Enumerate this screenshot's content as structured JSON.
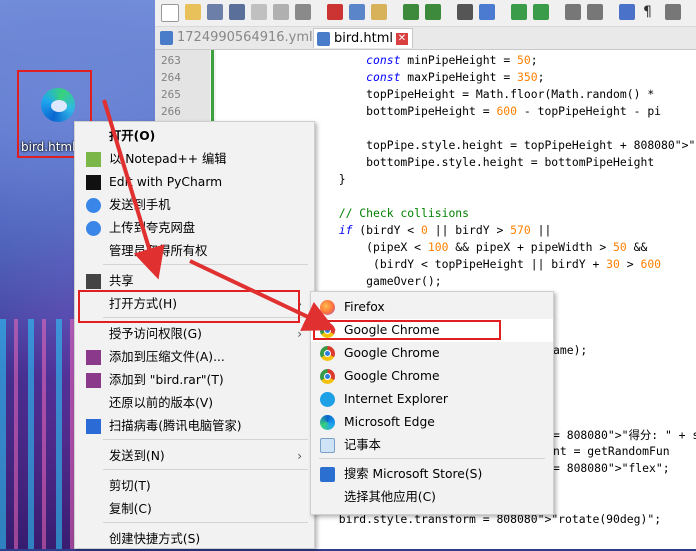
{
  "desktop": {
    "icon_label": "bird.html"
  },
  "editor": {
    "tabs": [
      {
        "label": "1724990564916.yml",
        "active": false
      },
      {
        "label": "bird.html",
        "active": true,
        "close": "✕"
      }
    ],
    "line_numbers": [
      "263",
      "264",
      "265",
      "266"
    ],
    "code_lines": [
      {
        "text": "      const minPipeHeight = 50;"
      },
      {
        "text": "      const maxPipeHeight = 350;"
      },
      {
        "text": "      topPipeHeight = Math.floor(Math.random() *"
      },
      {
        "text": "      bottomPipeHeight = 600 - topPipeHeight - pi"
      },
      {
        "text": ""
      },
      {
        "text": "      topPipe.style.height = topPipeHeight + \"px\""
      },
      {
        "text": "      bottomPipe.style.height = bottomPipeHeight"
      },
      {
        "text": "  }"
      },
      {
        "text": ""
      },
      {
        "text": "  // Check collisions"
      },
      {
        "text": "  if (birdY < 0 || birdY > 570 ||"
      },
      {
        "text": "      (pipeX < 100 && pipeX + pipeWidth > 50 &&"
      },
      {
        "text": "       (birdY < topPipeHeight || birdY + 30 > 600"
      },
      {
        "text": "      gameOver();"
      },
      {
        "text": "ame);"
      },
      {
        "text": "= \"得分: \" + scor"
      },
      {
        "text": "nt = getRandomFun"
      },
      {
        "text": "= \"flex\";"
      },
      {
        "text": "  bird.style.transform = \"rotate(90deg)\";"
      }
    ]
  },
  "context_menu": {
    "items": [
      {
        "label": "打开(O)",
        "icon": "none"
      },
      {
        "label": "以 Notepad++ 编辑",
        "icon": "notepadpp-icon"
      },
      {
        "label": "Edit with PyCharm",
        "icon": "pycharm-icon"
      },
      {
        "label": "发送到手机",
        "icon": "cloud-icon"
      },
      {
        "label": "上传到夸克网盘",
        "icon": "cloud-icon"
      },
      {
        "label": "管理员取得所有权",
        "icon": "none"
      },
      {
        "label": "共享",
        "icon": "share-icon"
      },
      {
        "label": "打开方式(H)",
        "icon": "none",
        "submenu": true
      },
      {
        "label": "授予访问权限(G)",
        "icon": "none",
        "submenu": true
      },
      {
        "label": "添加到压缩文件(A)...",
        "icon": "winrar-icon"
      },
      {
        "label": "添加到 \"bird.rar\"(T)",
        "icon": "winrar-icon"
      },
      {
        "label": "还原以前的版本(V)",
        "icon": "none"
      },
      {
        "label": "扫描病毒(腾讯电脑管家)",
        "icon": "shield-icon"
      },
      {
        "label": "发送到(N)",
        "icon": "none",
        "submenu": true
      },
      {
        "label": "剪切(T)",
        "icon": "none"
      },
      {
        "label": "复制(C)",
        "icon": "none"
      },
      {
        "label": "创建快捷方式(S)",
        "icon": "none"
      }
    ],
    "submenu_arrow": "›"
  },
  "open_with_submenu": {
    "items": [
      {
        "label": "Firefox",
        "icon": "firefox-icon"
      },
      {
        "label": "Google Chrome",
        "icon": "chrome-icon"
      },
      {
        "label": "Google Chrome",
        "icon": "chrome-icon"
      },
      {
        "label": "Google Chrome",
        "icon": "chrome-icon"
      },
      {
        "label": "Internet Explorer",
        "icon": "ie-icon"
      },
      {
        "label": "Microsoft Edge",
        "icon": "edge-icon"
      },
      {
        "label": "记事本",
        "icon": "notepad-icon"
      },
      {
        "label": "搜索 Microsoft Store(S)",
        "icon": "store-icon"
      },
      {
        "label": "选择其他应用(C)",
        "icon": "none"
      }
    ]
  },
  "colors": {
    "highlight_box": "#e02020",
    "annotation_arrow": "#e03030",
    "keyword": "#0000ff",
    "number": "#ff8000",
    "string": "#808080",
    "comment": "#008000"
  }
}
